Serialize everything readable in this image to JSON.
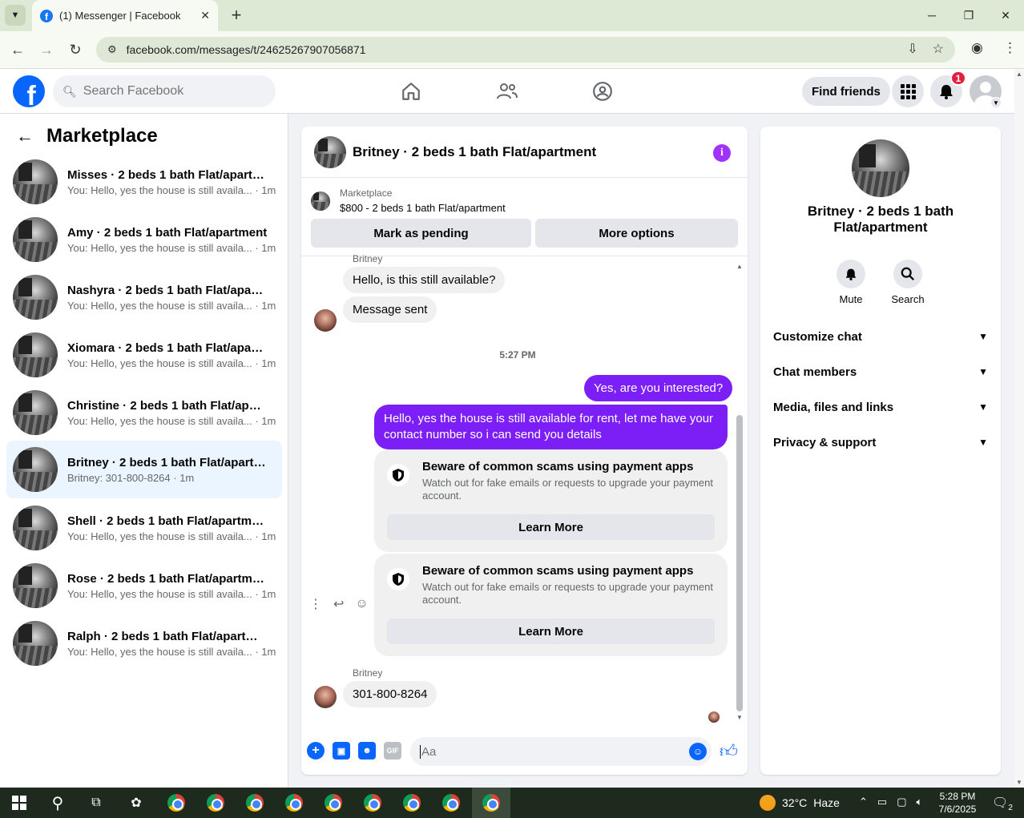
{
  "browser": {
    "tab_title": "(1) Messenger | Facebook",
    "url": "facebook.com/messages/t/24625267907056871",
    "new_tab": "+",
    "close_tab": "✕"
  },
  "header": {
    "search_placeholder": "Search Facebook",
    "find_friends": "Find friends",
    "notification_count": "1"
  },
  "sidebar": {
    "title": "Marketplace",
    "conversations": [
      {
        "name": "Misses · 2 beds 1 bath Flat/apartm...",
        "preview": "You: Hello, yes the house is still availa... · 1m"
      },
      {
        "name": "Amy · 2 beds 1 bath Flat/apartment",
        "preview": "You: Hello, yes the house is still availa... · 1m"
      },
      {
        "name": "Nashyra · 2 beds 1 bath Flat/apart...",
        "preview": "You: Hello, yes the house is still availa... · 1m"
      },
      {
        "name": "Xiomara · 2 beds 1 bath Flat/apart...",
        "preview": "You: Hello, yes the house is still availa... · 1m"
      },
      {
        "name": "Christine · 2 beds 1 bath Flat/apart...",
        "preview": "You: Hello, yes the house is still availa... · 1m"
      },
      {
        "name": "Britney · 2 beds 1 bath Flat/apartm...",
        "preview": "Britney: 301-800-8264 · 1m"
      },
      {
        "name": "Shell · 2 beds 1 bath Flat/apartment",
        "preview": "You: Hello, yes the house is still availa... · 1m"
      },
      {
        "name": "Rose · 2 beds 1 bath Flat/apartment",
        "preview": "You: Hello, yes the house is still availa... · 1m"
      },
      {
        "name": "Ralph · 2 beds 1 bath Flat/apartment",
        "preview": "You: Hello, yes the house is still availa... · 1m"
      }
    ]
  },
  "chat": {
    "title": "Britney · 2 beds 1 bath Flat/apartment",
    "marketplace_label": "Marketplace",
    "listing": "$800 - 2 beds 1 bath Flat/apartment",
    "mark_pending": "Mark as pending",
    "more_options": "More options",
    "sender": "Britney",
    "msg_in_1": "Hello, is this still available?",
    "msg_in_2": "Message sent",
    "timestamp": "5:27 PM",
    "msg_out_1": "Yes, are you interested?",
    "msg_out_2": "Hello, yes the house is still available for rent, let me have your contact number so i can send you details",
    "warning_title": "Beware of common scams using payment apps",
    "warning_body": "Watch out for fake emails or requests to upgrade your payment account.",
    "learn_more": "Learn More",
    "msg_in_3": "301-800-8264",
    "composer_placeholder": "Aa"
  },
  "info_panel": {
    "title": "Britney · 2 beds 1 bath Flat/apartment",
    "mute": "Mute",
    "search": "Search",
    "rows": [
      "Customize chat",
      "Chat members",
      "Media, files and links",
      "Privacy & support"
    ]
  },
  "taskbar": {
    "temperature": "32°C",
    "weather": "Haze",
    "time": "5:28 PM",
    "date": "7/6/2025",
    "notifications": "2"
  },
  "colors": {
    "fb_blue": "#0866ff",
    "messenger_purple": "#7c1ff7",
    "active_conv": "#ebf5ff"
  }
}
